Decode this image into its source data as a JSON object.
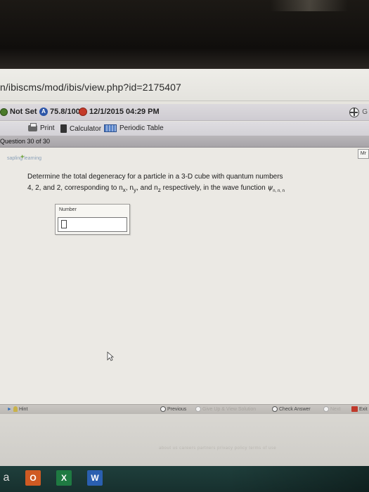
{
  "browser": {
    "url": "n/ibiscms/mod/ibis/view.php?id=2175407"
  },
  "status_bar": {
    "not_set_label": "Not Set",
    "score": "75.8/100",
    "due_date": "12/1/2015 04:29 PM",
    "right_letter": "G"
  },
  "toolbar": {
    "print_label": "Print",
    "calculator_label": "Calculator",
    "periodic_table_label": "Periodic Table"
  },
  "question_nav": {
    "label": "Question 30 of 30"
  },
  "content": {
    "logo_text": "sapling learning",
    "more_tab": "Mr",
    "question_line1": "Determine the total degeneracy for a particle in a 3-D cube with quantum numbers",
    "question_line2_prefix": "4, 2, and 2, corresponding to n",
    "question_line2_mid1": ", n",
    "question_line2_mid2": ", and n",
    "question_line2_suffix": " respectively, in the wave function ",
    "psi_symbol": "ψ",
    "sub_x": "x",
    "sub_y": "y",
    "sub_z": "z",
    "psi_subscript": "n, n, n",
    "answer_label": "Number",
    "answer_value": ""
  },
  "bottom_bar": {
    "hint": "Hint",
    "previous": "Previous",
    "give_up": "Give Up & View Solution",
    "check_answer": "Check Answer",
    "next": "Next",
    "exit": "Exit"
  },
  "footer": {
    "links": "about us   careers   partners   privacy policy   terms of use"
  },
  "taskbar": {
    "app_a": "a",
    "app_office": "O",
    "app_excel": "X",
    "app_word": "W"
  }
}
